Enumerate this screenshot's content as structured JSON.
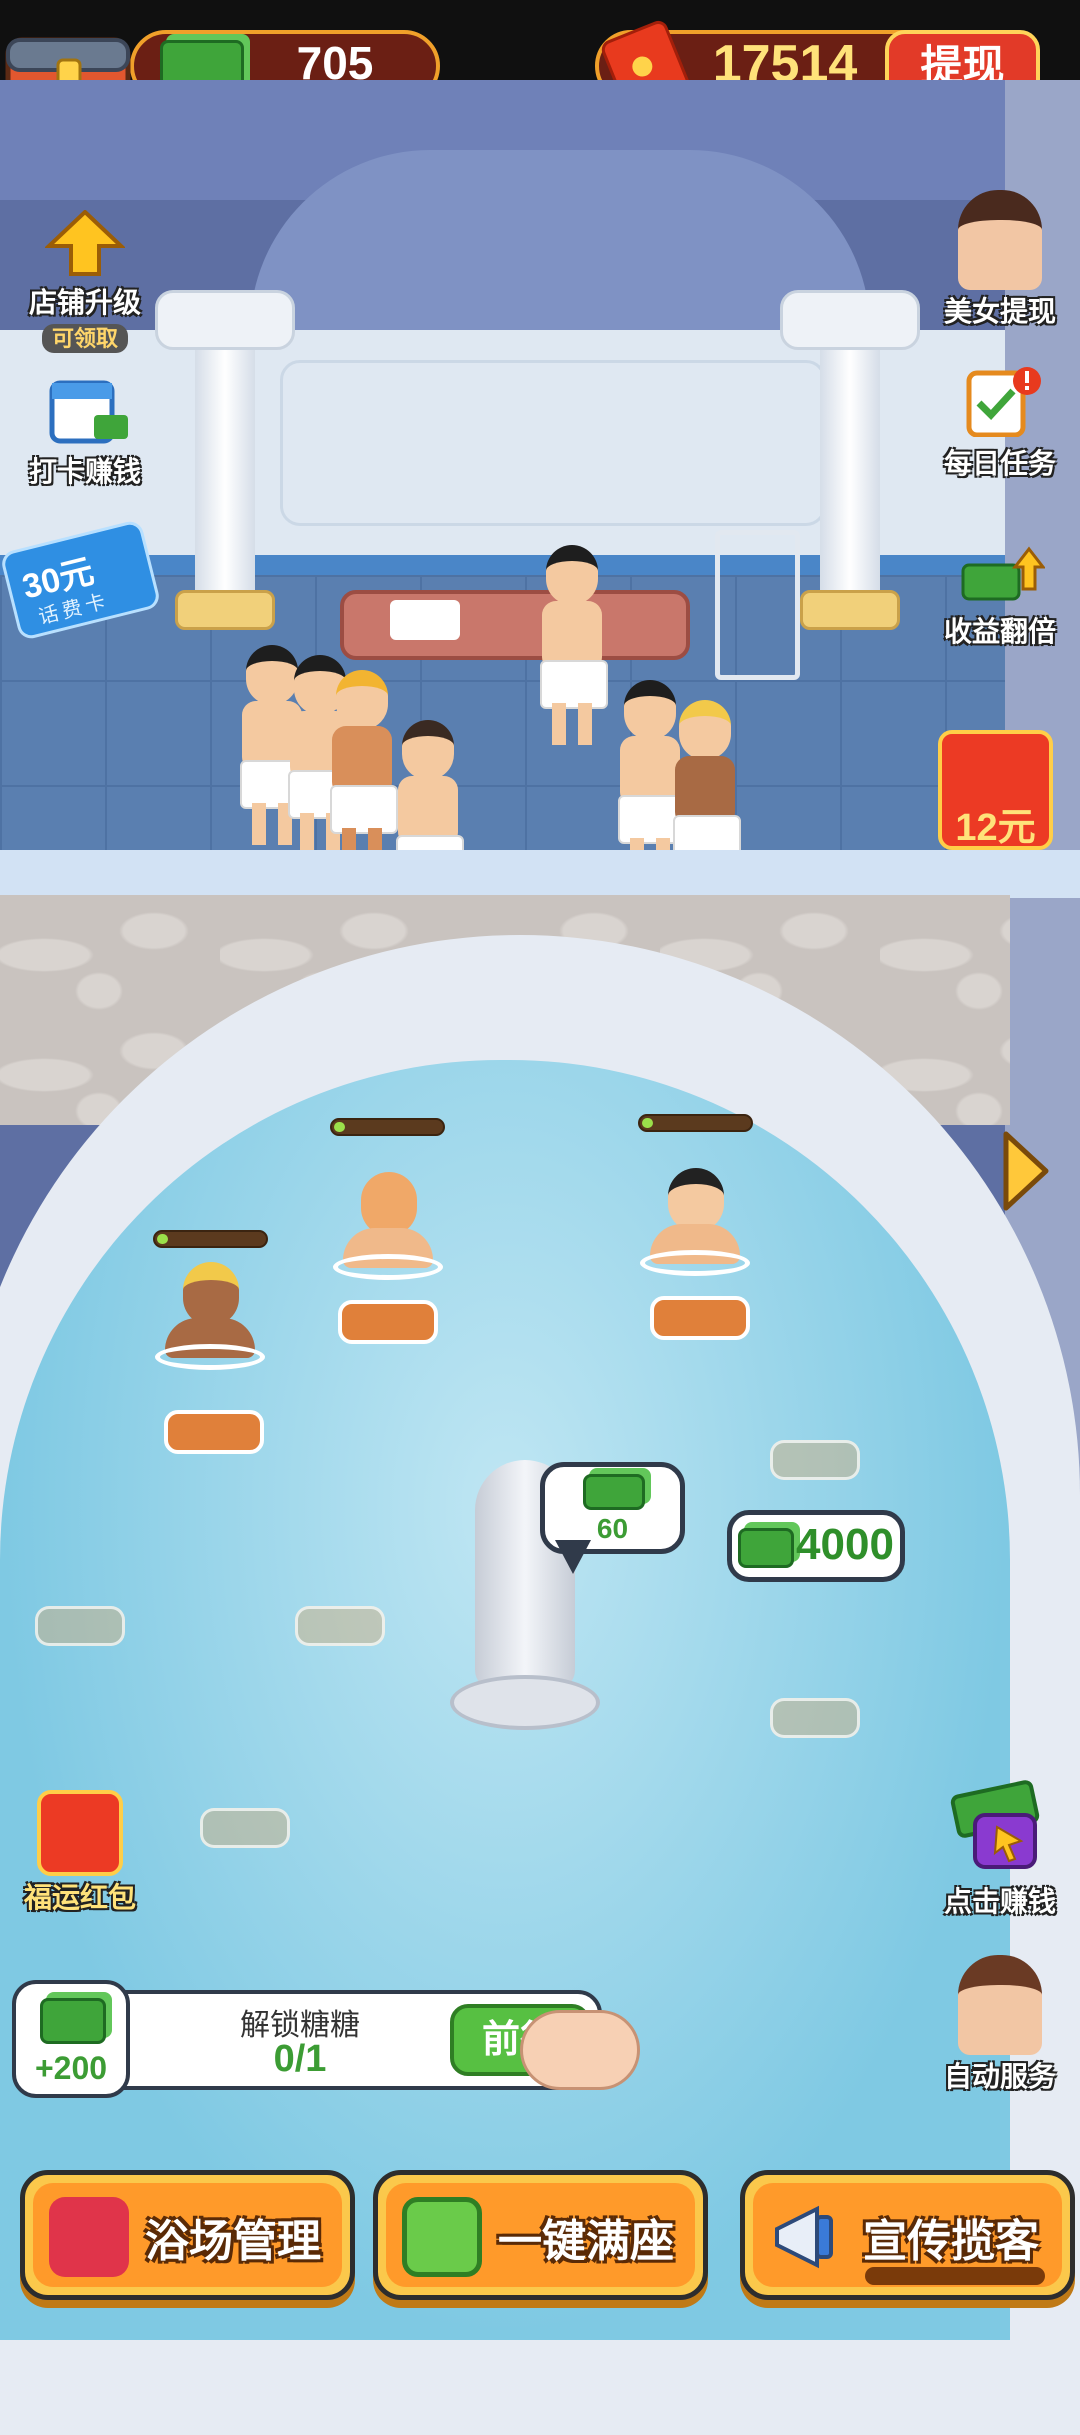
{
  "header": {
    "cash": "705",
    "red_balance": "17514",
    "withdraw_label": "提现"
  },
  "left_menu": {
    "shop_upgrade": "店铺升级",
    "shop_upgrade_tag": "可领取",
    "checkin": "打卡赚钱",
    "voucher_amount": "30元",
    "voucher_sub": "话费卡"
  },
  "right_menu": {
    "beauty_withdraw": "美女提现",
    "daily_task": "每日任务",
    "income_double": "收益翻倍",
    "redpack_amount": "12元"
  },
  "pool": {
    "bubble_value": "60",
    "earn_value": "4000",
    "bathers": [
      {
        "hp": 0.1
      },
      {
        "hp": 0.1
      },
      {
        "hp": 0.1
      }
    ]
  },
  "lower_left": {
    "lucky_redpack": "福运红包"
  },
  "lower_right": {
    "click_earn": "点击赚钱",
    "auto_service": "自动服务"
  },
  "task": {
    "reward": "+200",
    "title": "解锁糖糖",
    "progress": "0/1",
    "go_label": "前往"
  },
  "actions": {
    "bath_manage": "浴场管理",
    "fill_seats": "一键满座",
    "promote": "宣传揽客"
  },
  "icons": {
    "cash": "money-stack-icon",
    "red": "red-envelope-icon",
    "upgrade": "upgrade-arrow-icon",
    "calendar": "calendar-icon",
    "task": "clipboard-icon",
    "double": "money-up-icon",
    "megaphone": "megaphone-icon",
    "tv": "tv-icon",
    "sofa": "sofa-icon"
  },
  "colors": {
    "accent_orange": "#ff9a2a",
    "accent_yellow": "#fbc84b",
    "money_green": "#3c9c34",
    "red": "#e23a28"
  }
}
